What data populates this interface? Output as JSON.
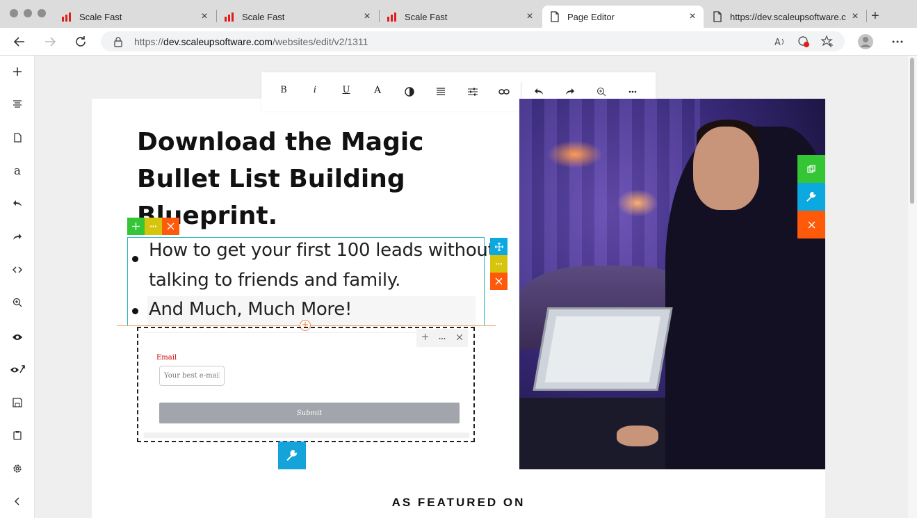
{
  "browser": {
    "tabs": [
      {
        "label": "Scale Fast",
        "icon": "scalefast-logo-icon",
        "active": false
      },
      {
        "label": "Scale Fast",
        "icon": "scalefast-logo-icon",
        "active": false
      },
      {
        "label": "Scale Fast",
        "icon": "scalefast-logo-icon",
        "active": false
      },
      {
        "label": "Page Editor",
        "icon": "page-icon",
        "active": true
      },
      {
        "label": "https://dev.scaleupsoftware.c",
        "icon": "page-icon",
        "active": false
      }
    ],
    "url_prefix": "https://",
    "url_host": "dev.scaleupsoftware.com",
    "url_path": "/websites/edit/v2/1311",
    "new_tab_label": "+"
  },
  "toolbar": {
    "bold": "B",
    "italic": "i",
    "underline": "U",
    "font": "A"
  },
  "sidebar_icons": [
    "plus-icon",
    "lines-icon",
    "page-icon",
    "text-icon",
    "undo-icon",
    "redo-icon",
    "code-icon",
    "zoom-icon",
    "eye-icon",
    "preview-icon",
    "save-icon",
    "clipboard-icon",
    "settings-icon",
    "collapse-icon"
  ],
  "sidebar_text": {
    "text_tool": "a"
  },
  "content": {
    "headline": "Download the Magic Bullet List Building Blueprint.",
    "list_items": [
      "How to get your first 100 leads without",
      "talking to friends and family.",
      "And Much, Much More!"
    ],
    "form": {
      "email_label": "Email",
      "email_placeholder": "Your best e-mail",
      "submit_label": "Submit"
    },
    "featured_label": "AS FEATURED ON"
  },
  "colors": {
    "green": "#35c635",
    "yellow": "#d7c50d",
    "orange": "#ff5a0a",
    "blue": "#0ca8e0"
  }
}
